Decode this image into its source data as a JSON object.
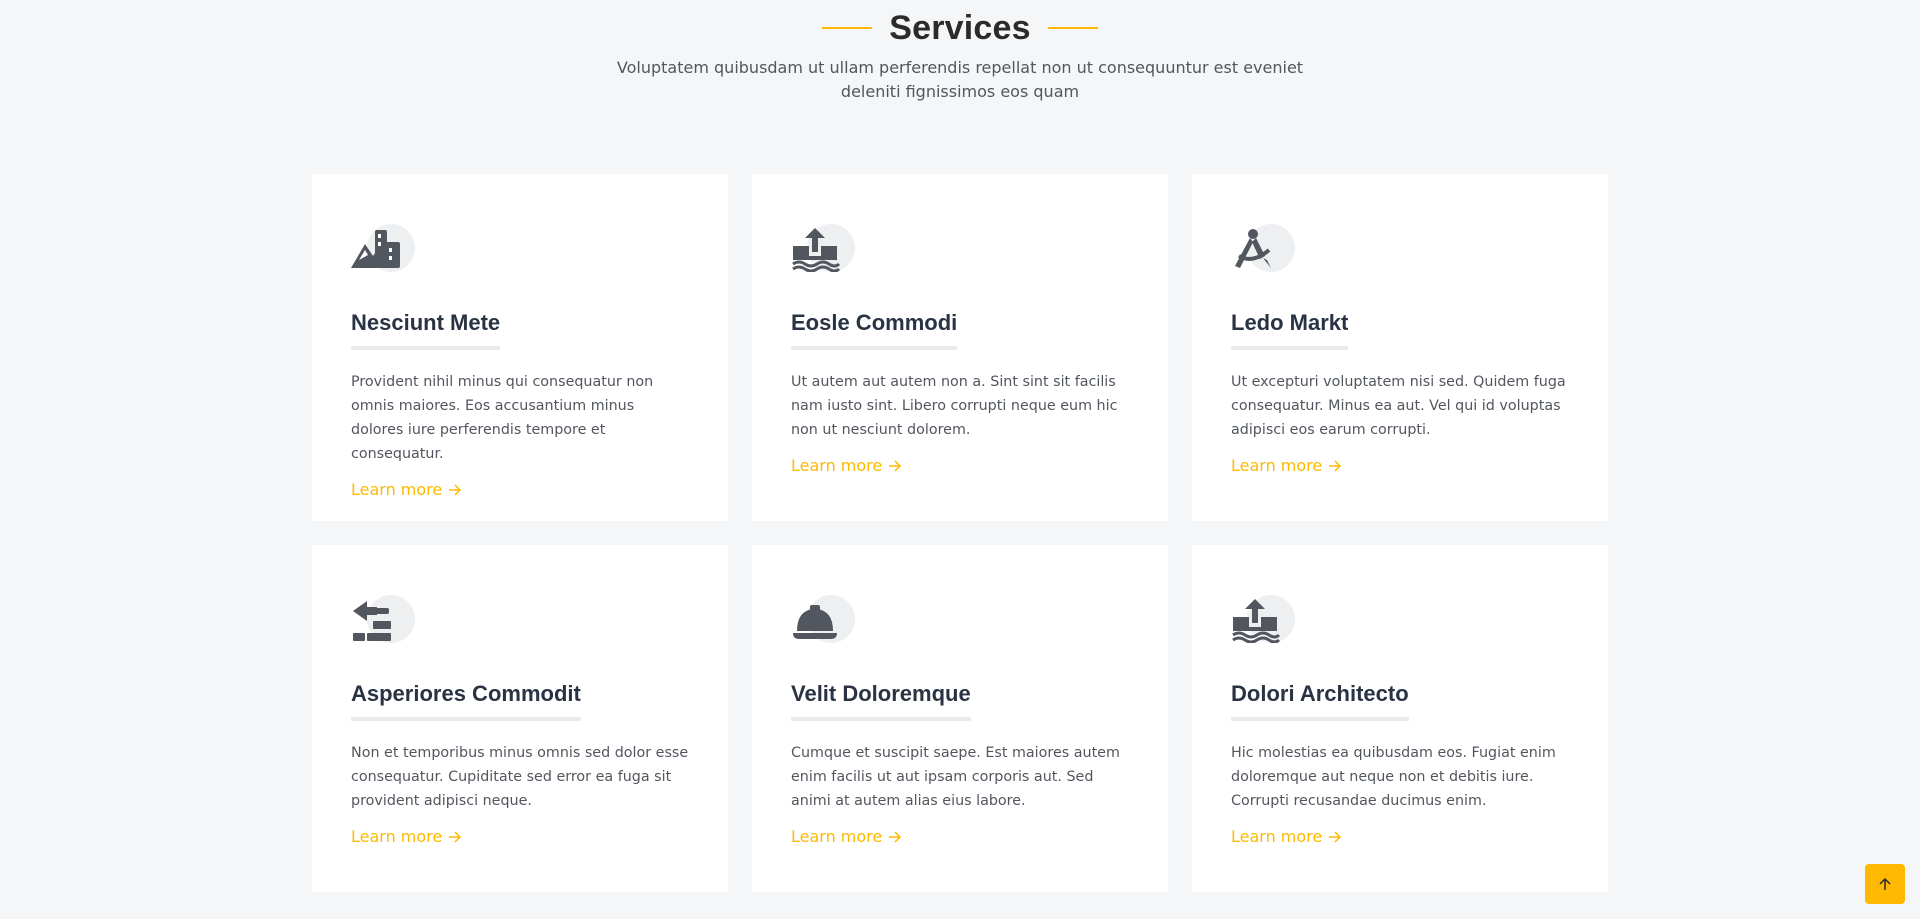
{
  "section": {
    "title": "Services",
    "description": "Voluptatem quibusdam ut ullam perferendis repellat non ut consequuntur est eveniet deleniti fignissimos eos quam"
  },
  "colors": {
    "accent": "#feb900",
    "card_bg": "#ffffff",
    "page_bg": "#f5f6f7",
    "heading": "#2a3344",
    "icon": "#52565e"
  },
  "services": [
    {
      "icon": "mountain-city-icon",
      "title": "Nesciunt Mete",
      "text": "Provident nihil minus qui consequatur non omnis maiores. Eos accusantium minus dolores iure perferendis tempore et consequatur.",
      "link": "Learn more"
    },
    {
      "icon": "arrow-up-from-water-icon",
      "title": "Eosle Commodi",
      "text": "Ut autem aut autem non a. Sint sint sit facilis nam iusto sint. Libero corrupti neque eum hic non ut nesciunt dolorem.",
      "link": "Learn more"
    },
    {
      "icon": "compass-drafting-icon",
      "title": "Ledo Markt",
      "text": "Ut excepturi voluptatem nisi sed. Quidem fuga consequatur. Minus ea aut. Vel qui id voluptas adipisci eos earum corrupti.",
      "link": "Learn more"
    },
    {
      "icon": "trowel-bricks-icon",
      "title": "Asperiores Commodit",
      "text": "Non et temporibus minus omnis sed dolor esse consequatur. Cupiditate sed error ea fuga sit provident adipisci neque.",
      "link": "Learn more"
    },
    {
      "icon": "helmet-safety-icon",
      "title": "Velit Doloremque",
      "text": "Cumque et suscipit saepe. Est maiores autem enim facilis ut aut ipsam corporis aut. Sed animi at autem alias eius labore.",
      "link": "Learn more"
    },
    {
      "icon": "arrow-up-from-water-icon",
      "title": "Dolori Architecto",
      "text": "Hic molestias ea quibusdam eos. Fugiat enim doloremque aut neque non et debitis iure. Corrupti recusandae ducimus enim.",
      "link": "Learn more"
    }
  ],
  "scroll_top": {
    "icon": "arrow-up-icon"
  }
}
